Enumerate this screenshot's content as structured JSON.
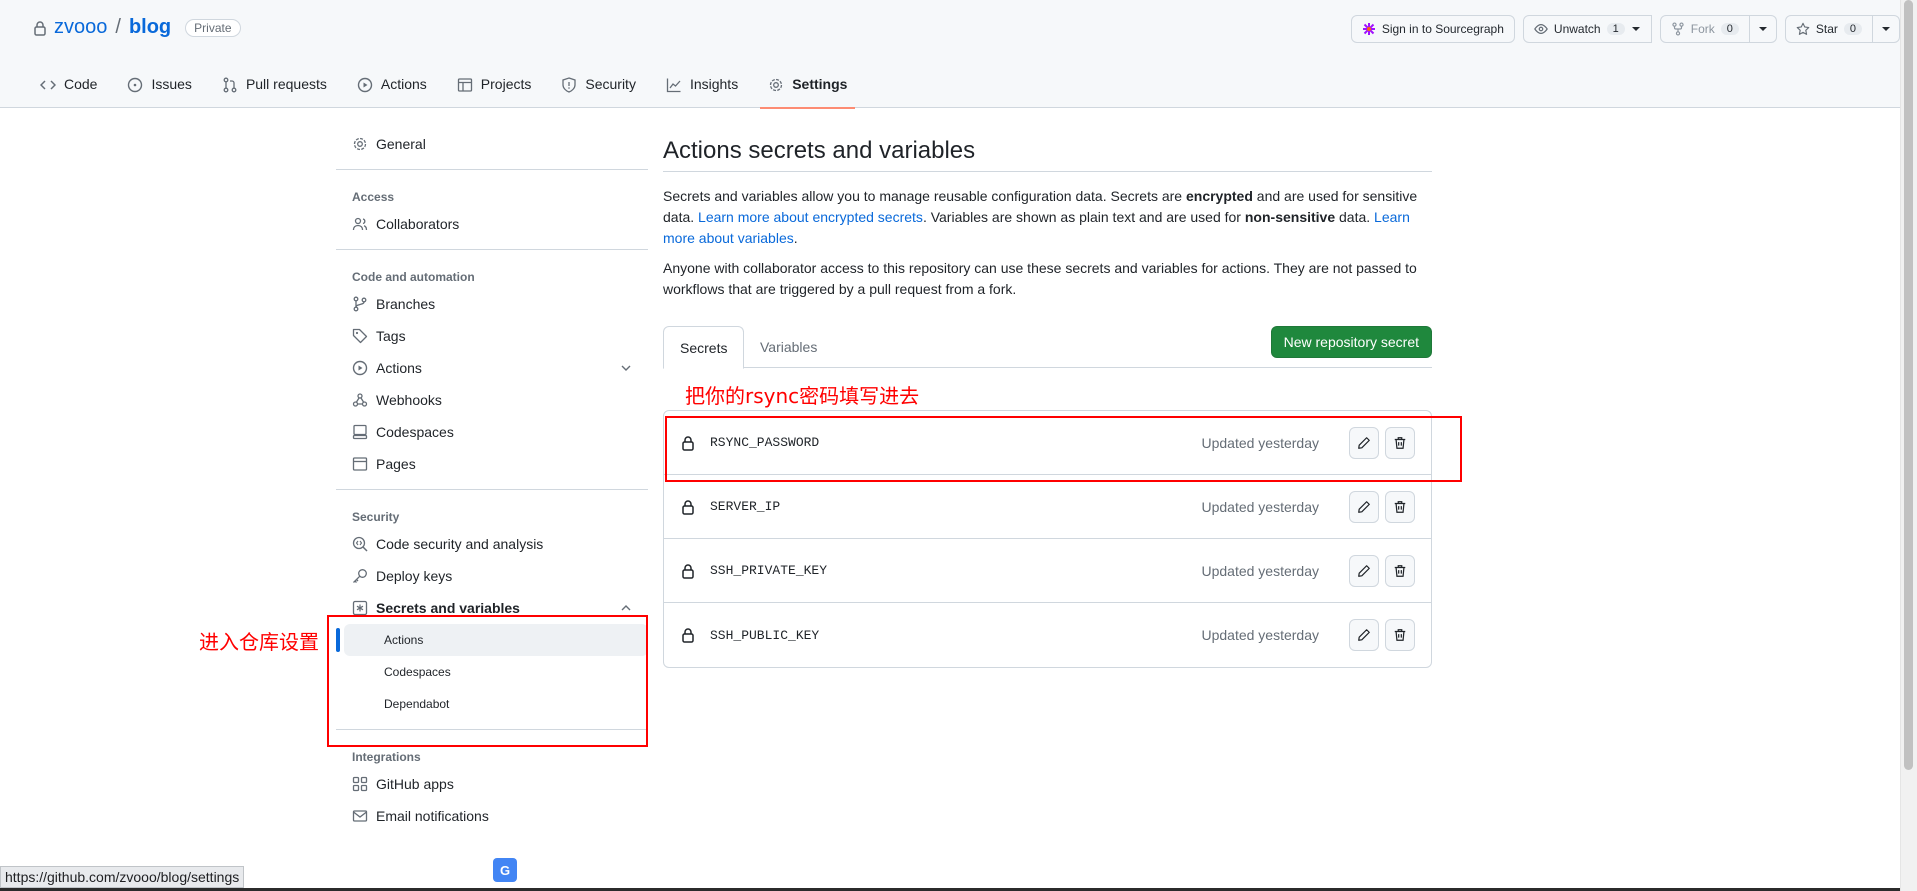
{
  "repo": {
    "owner": "zvooo",
    "separator": "/",
    "name": "blog",
    "visibility": "Private"
  },
  "header_actions": {
    "sourcegraph": "Sign in to Sourcegraph",
    "unwatch": "Unwatch",
    "unwatch_count": "1",
    "fork": "Fork",
    "fork_count": "0",
    "star": "Star",
    "star_count": "0"
  },
  "nav": {
    "code": "Code",
    "issues": "Issues",
    "pulls": "Pull requests",
    "actions": "Actions",
    "projects": "Projects",
    "security": "Security",
    "insights": "Insights",
    "settings": "Settings"
  },
  "sidebar": {
    "general": "General",
    "access_heading": "Access",
    "collaborators": "Collaborators",
    "code_heading": "Code and automation",
    "branches": "Branches",
    "tags": "Tags",
    "actions": "Actions",
    "webhooks": "Webhooks",
    "codespaces": "Codespaces",
    "pages": "Pages",
    "security_heading": "Security",
    "code_security": "Code security and analysis",
    "deploy_keys": "Deploy keys",
    "secrets_vars": "Secrets and variables",
    "sub_actions": "Actions",
    "sub_codespaces": "Codespaces",
    "sub_dependabot": "Dependabot",
    "integrations_heading": "Integrations",
    "github_apps": "GitHub apps",
    "email_notifications": "Email notifications"
  },
  "main": {
    "title": "Actions secrets and variables",
    "desc1_a": "Secrets and variables allow you to manage reusable configuration data. Secrets are ",
    "desc1_b": "encrypted",
    "desc1_c": " and are used for sensitive data. ",
    "desc1_link1": "Learn more about encrypted secrets",
    "desc1_d": ". Variables are shown as plain text and are used for ",
    "desc1_e": "non-sensitive",
    "desc1_f": " data. ",
    "desc1_link2": "Learn more about variables",
    "desc1_g": ".",
    "desc2": "Anyone with collaborator access to this repository can use these secrets and variables for actions. They are not passed to workflows that are triggered by a pull request from a fork.",
    "tab_secrets": "Secrets",
    "tab_variables": "Variables",
    "new_secret": "New repository secret",
    "secrets": [
      {
        "name": "RSYNC_PASSWORD",
        "updated": "Updated yesterday"
      },
      {
        "name": "SERVER_IP",
        "updated": "Updated yesterday"
      },
      {
        "name": "SSH_PRIVATE_KEY",
        "updated": "Updated yesterday"
      },
      {
        "name": "SSH_PUBLIC_KEY",
        "updated": "Updated yesterday"
      }
    ]
  },
  "annotations": {
    "fill_rsync": "把你的rsync密码填写进去",
    "enter_settings": "进入仓库设置"
  },
  "status": {
    "url": "https://github.com/zvooo/blog/settings"
  },
  "colors": {
    "accent": "#0969da",
    "primary_button": "#1f883d",
    "nav_underline": "#fd8c73",
    "annotation": "#ff0000"
  }
}
